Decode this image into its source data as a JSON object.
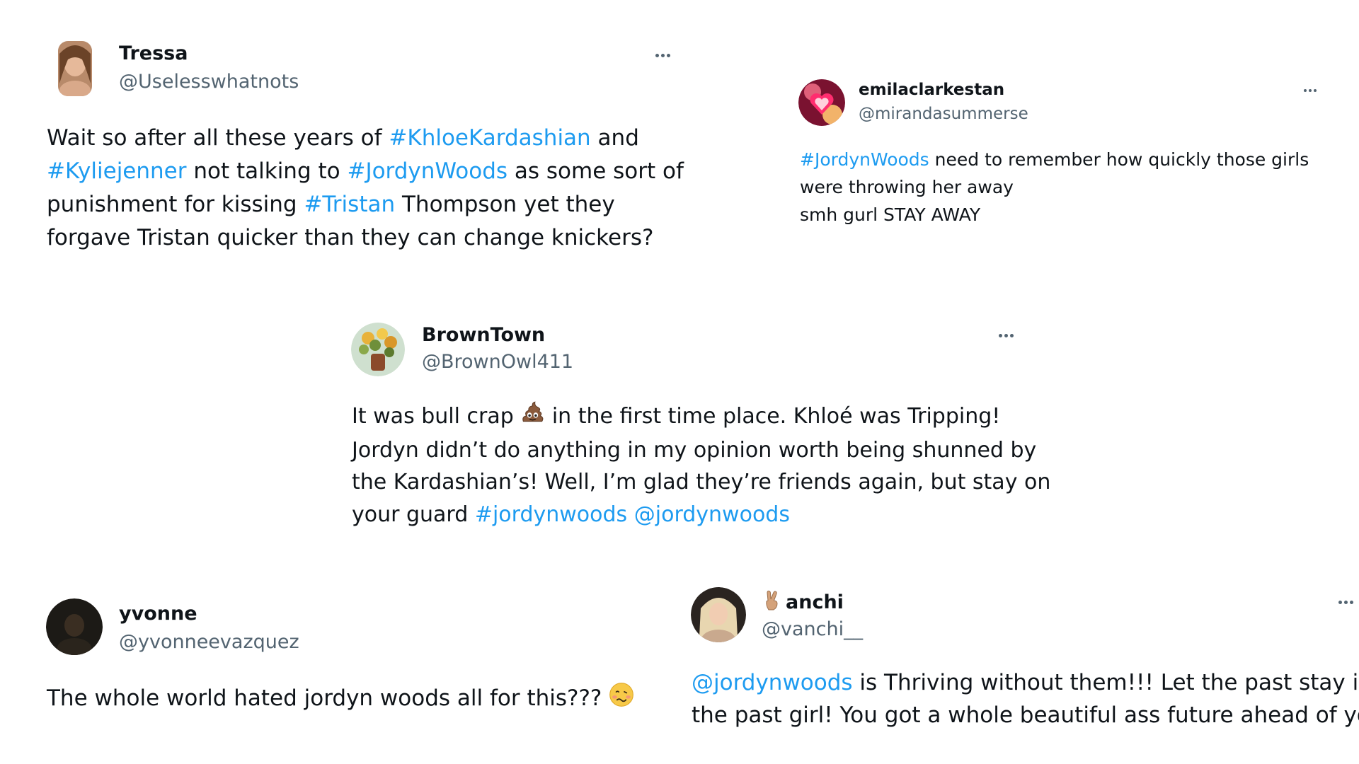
{
  "tweets": [
    {
      "name": "Tressa",
      "handle": "@Uselesswhatnots",
      "lines": [
        [
          {
            "t": "Wait so after all these years of "
          },
          {
            "t": "#KhloeKardashian",
            "link": true
          },
          {
            "t": " and"
          }
        ],
        [
          {
            "t": "#Kyliejenner",
            "link": true
          },
          {
            "t": " not talking to "
          },
          {
            "t": "#JordynWoods",
            "link": true
          },
          {
            "t": " as some sort of"
          }
        ],
        [
          {
            "t": "punishment for kissing "
          },
          {
            "t": "#Tristan",
            "link": true
          },
          {
            "t": " Thompson yet they"
          }
        ],
        [
          {
            "t": "forgave Tristan quicker than they can change knickers?"
          }
        ]
      ]
    },
    {
      "name": "emilaclarkestan",
      "handle": "@mirandasummerse",
      "lines": [
        [
          {
            "t": "#JordynWoods",
            "link": true
          },
          {
            "t": " need to remember how quickly those girls"
          }
        ],
        [
          {
            "t": "were throwing her away"
          }
        ],
        [
          {
            "t": "smh gurl STAY AWAY"
          }
        ]
      ]
    },
    {
      "name": "BrownTown",
      "handle": "@BrownOwl411",
      "lines": [
        [
          {
            "t": "It was bull crap "
          },
          {
            "emoji": "poop"
          },
          {
            "t": " in the first time place. Khloé was Tripping!"
          }
        ],
        [
          {
            "t": "Jordyn didn’t do anything in my opinion worth being shunned by"
          }
        ],
        [
          {
            "t": "the Kardashian’s! Well, I’m glad they’re friends again, but stay on"
          }
        ],
        [
          {
            "t": "your guard "
          },
          {
            "t": "#jordynwoods",
            "link": true
          },
          {
            "t": " "
          },
          {
            "t": "@jordynwoods",
            "link": true
          }
        ]
      ]
    },
    {
      "name": "yvonne",
      "handle": "@yvonneevazquez",
      "lines": [
        [
          {
            "t": "The whole world hated jordyn woods all for this??? "
          },
          {
            "emoji": "woozy"
          }
        ]
      ]
    },
    {
      "name": "anchi",
      "name_emoji": "victory-hand",
      "handle": "@vanchi__",
      "lines": [
        [
          {
            "t": "@jordynwoods",
            "link": true
          },
          {
            "t": " is Thriving without them!!! Let the past stay in"
          }
        ],
        [
          {
            "t": "the past girl! You got a whole beautiful ass future ahead of you"
          }
        ]
      ]
    }
  ],
  "colors": {
    "link": "#1d9bf0",
    "text": "#0f1419",
    "handle": "#536471"
  },
  "icons": {
    "more": "more-options-icon",
    "poop": "pile-of-poo-emoji",
    "woozy": "woozy-face-emoji",
    "victory-hand": "victory-hand-emoji"
  }
}
